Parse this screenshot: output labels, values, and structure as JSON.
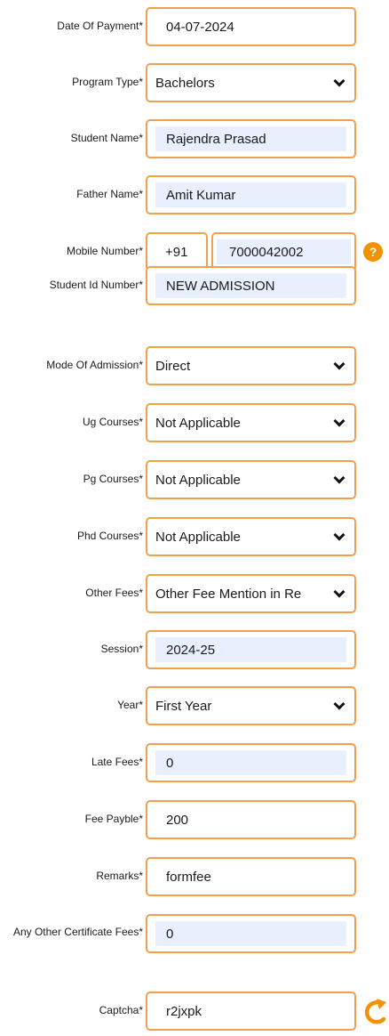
{
  "form": {
    "date_of_payment": {
      "label": "Date Of Payment*",
      "value": "04-07-2024"
    },
    "program_type": {
      "label": "Program Type*",
      "value": "Bachelors"
    },
    "student_name": {
      "label": "Student Name*",
      "value": "Rajendra Prasad"
    },
    "father_name": {
      "label": "Father Name*",
      "value": "Amit Kumar"
    },
    "mobile_number": {
      "label": "Mobile Number*",
      "country_code": "+91",
      "value": "7000042002",
      "help_icon": "question-icon",
      "help_text": "?"
    },
    "student_id": {
      "label": "Student Id Number*",
      "value": "NEW ADMISSION"
    },
    "mode_of_admission": {
      "label": "Mode Of Admission*",
      "value": "Direct"
    },
    "ug_courses": {
      "label": "Ug Courses*",
      "value": "Not Applicable"
    },
    "pg_courses": {
      "label": "Pg Courses*",
      "value": "Not Applicable"
    },
    "phd_courses": {
      "label": "Phd Courses*",
      "value": "Not Applicable"
    },
    "other_fees": {
      "label": "Other Fees*",
      "value": "Other Fee Mention in Re"
    },
    "session": {
      "label": "Session*",
      "value": "2024-25"
    },
    "year": {
      "label": "Year*",
      "value": "First Year"
    },
    "late_fees": {
      "label": "Late Fees*",
      "value": "0"
    },
    "fee_payble": {
      "label": "Fee Payble*",
      "value": "200"
    },
    "remarks": {
      "label": "Remarks*",
      "value": "formfee"
    },
    "certificate_fees": {
      "label": "Any Other Certificate Fees*",
      "value": "0"
    },
    "captcha": {
      "label": "Captcha*",
      "value": "r2jxpk",
      "refresh_icon": "refresh-icon"
    }
  },
  "colors": {
    "border": "#f0a050",
    "autofill": "#e8f0fe",
    "help": "#f39200"
  }
}
